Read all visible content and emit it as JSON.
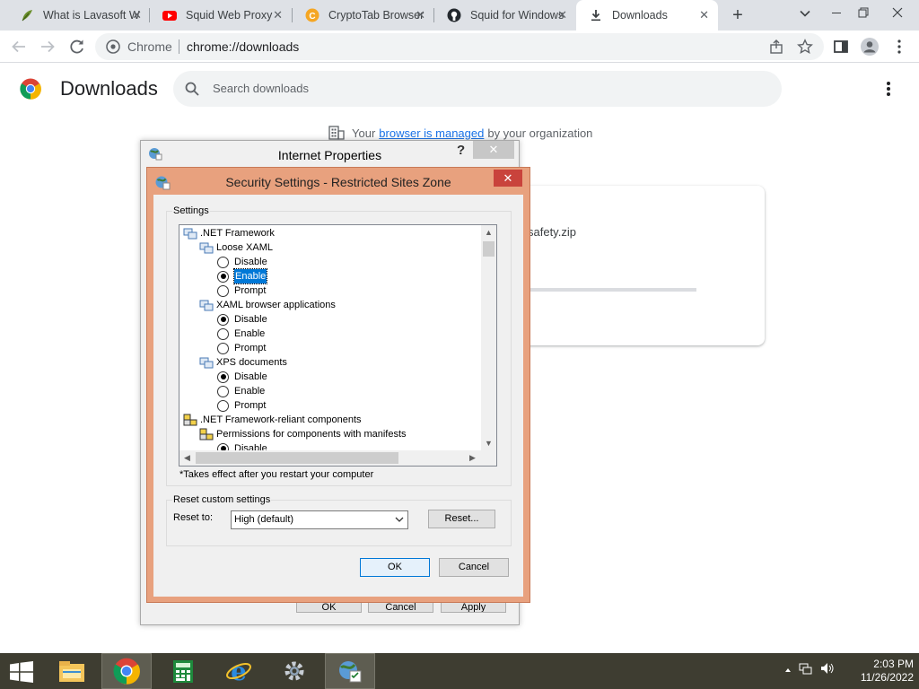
{
  "tabs": [
    {
      "title": "What is Lavasoft W",
      "icon": "lavasoft-leaf-icon",
      "close": "✕"
    },
    {
      "title": "Squid Web Proxy",
      "icon": "youtube-icon",
      "close": "✕"
    },
    {
      "title": "CryptoTab Browser",
      "icon": "cryptotab-icon",
      "close": "✕"
    },
    {
      "title": "Squid for Windows",
      "icon": "github-icon",
      "close": "✕"
    },
    {
      "title": "Downloads",
      "icon": "download-icon",
      "close": "✕",
      "active": true
    }
  ],
  "toolbar": {
    "new_tab": "+",
    "site_label": "Chrome",
    "url": "chrome://downloads"
  },
  "downloads": {
    "title": "Downloads",
    "search_placeholder": "Search downloads",
    "managed_prefix": "Your",
    "managed_link": "browser is managed",
    "managed_suffix": "by your organization",
    "file_name": "safety.zip"
  },
  "internet_properties": {
    "title": "Internet Properties",
    "help": "?",
    "close": "✕",
    "buttons": [
      "OK",
      "Cancel",
      "Apply"
    ]
  },
  "security_settings": {
    "title": "Security Settings - Restricted Sites Zone",
    "close": "✕",
    "settings_label": "Settings",
    "tree": [
      {
        "label": ".NET Framework",
        "type": "category"
      },
      {
        "label": "Loose XAML",
        "type": "setting"
      },
      {
        "label": "Disable",
        "type": "option",
        "checked": false
      },
      {
        "label": "Enable",
        "type": "option",
        "checked": true,
        "selected": true
      },
      {
        "label": "Prompt",
        "type": "option",
        "checked": false
      },
      {
        "label": "XAML browser applications",
        "type": "setting"
      },
      {
        "label": "Disable",
        "type": "option",
        "checked": true
      },
      {
        "label": "Enable",
        "type": "option",
        "checked": false
      },
      {
        "label": "Prompt",
        "type": "option",
        "checked": false
      },
      {
        "label": "XPS documents",
        "type": "setting"
      },
      {
        "label": "Disable",
        "type": "option",
        "checked": true
      },
      {
        "label": "Enable",
        "type": "option",
        "checked": false
      },
      {
        "label": "Prompt",
        "type": "option",
        "checked": false
      },
      {
        "label": ".NET Framework-reliant components",
        "type": "category"
      },
      {
        "label": "Permissions for components with manifests",
        "type": "setting"
      },
      {
        "label": "Disable",
        "type": "option",
        "checked": true
      }
    ],
    "restart_note": "*Takes effect after you restart your computer",
    "reset_group_label": "Reset custom settings",
    "reset_to_label": "Reset to:",
    "reset_to_value": "High (default)",
    "reset_button": "Reset...",
    "ok_button": "OK",
    "cancel_button": "Cancel"
  },
  "taskbar": {
    "apps": [
      "file-explorer-icon",
      "chrome-icon",
      "calculator-icon",
      "internet-explorer-icon",
      "control-panel-icon",
      "internet-options-icon"
    ],
    "time": "2:03 PM",
    "date": "11/26/2022"
  },
  "colors": {
    "dialog_frame": "#e8a17e",
    "dialog_close": "#c9433c",
    "taskbar": "#3e3d31",
    "link": "#1a73e8",
    "selection": "#0078d7"
  }
}
